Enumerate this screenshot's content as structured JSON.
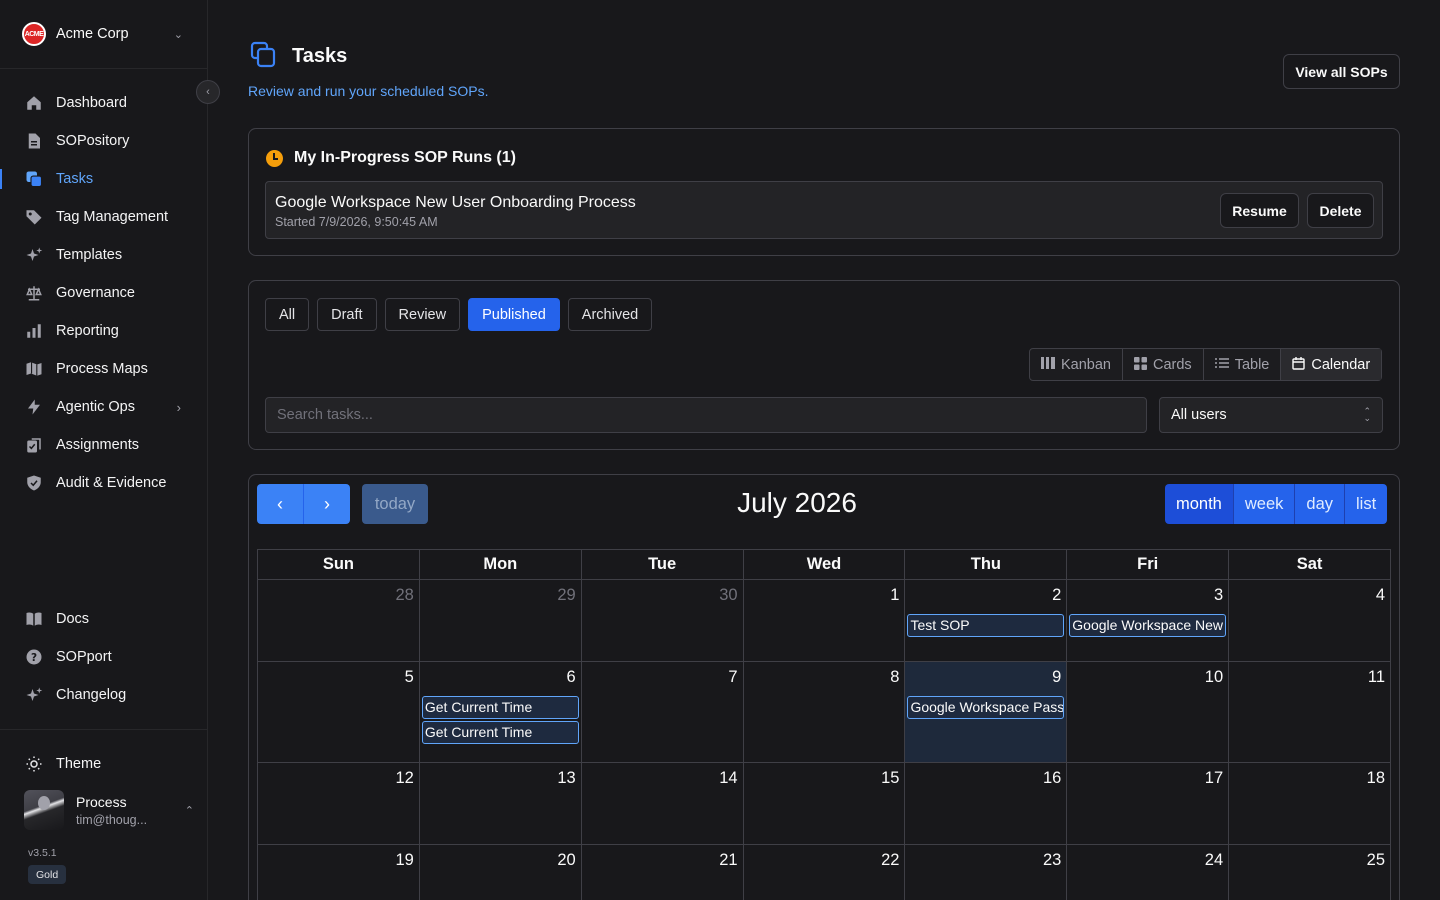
{
  "org": {
    "name": "Acme Corp",
    "logo_text": "ACME"
  },
  "sidebar": {
    "items": [
      {
        "label": "Dashboard",
        "icon": "home-icon"
      },
      {
        "label": "SOPository",
        "icon": "document-icon"
      },
      {
        "label": "Tasks",
        "icon": "copy-icon",
        "active": true
      },
      {
        "label": "Tag Management",
        "icon": "tag-icon"
      },
      {
        "label": "Templates",
        "icon": "sparkles-icon"
      },
      {
        "label": "Governance",
        "icon": "scale-icon"
      },
      {
        "label": "Reporting",
        "icon": "bar-chart-icon"
      },
      {
        "label": "Process Maps",
        "icon": "map-icon"
      },
      {
        "label": "Agentic Ops",
        "icon": "bolt-icon"
      },
      {
        "label": "Assignments",
        "icon": "clipboard-icon"
      },
      {
        "label": "Audit & Evidence",
        "icon": "shield-icon"
      }
    ],
    "footer_items": [
      {
        "label": "Docs",
        "icon": "book-icon"
      },
      {
        "label": "SOPport",
        "icon": "help-circle-icon"
      },
      {
        "label": "Changelog",
        "icon": "sparkles-icon"
      }
    ],
    "theme_label": "Theme",
    "user": {
      "name": "Process",
      "email": "tim@thoug..."
    },
    "version": "v3.5.1",
    "plan": "Gold"
  },
  "page": {
    "title": "Tasks",
    "subtitle": "Review and run your scheduled SOPs.",
    "view_all_label": "View all SOPs"
  },
  "in_progress": {
    "title": "My In-Progress SOP Runs (1)",
    "runs": [
      {
        "name": "Google Workspace New User Onboarding Process",
        "started": "Started 7/9/2026, 9:50:45 AM"
      }
    ],
    "resume_label": "Resume",
    "delete_label": "Delete"
  },
  "filters": {
    "tabs": [
      "All",
      "Draft",
      "Review",
      "Published",
      "Archived"
    ],
    "active_tab": "Published",
    "views": [
      "Kanban",
      "Cards",
      "Table",
      "Calendar"
    ],
    "active_view": "Calendar",
    "search_placeholder": "Search tasks...",
    "user_filter": "All users"
  },
  "calendar": {
    "title": "July 2026",
    "today_label": "today",
    "modes": [
      "month",
      "week",
      "day",
      "list"
    ],
    "active_mode": "month",
    "weekdays": [
      "Sun",
      "Mon",
      "Tue",
      "Wed",
      "Thu",
      "Fri",
      "Sat"
    ],
    "weeks": [
      [
        {
          "n": "28",
          "other": true
        },
        {
          "n": "29",
          "other": true
        },
        {
          "n": "30",
          "other": true
        },
        {
          "n": "1"
        },
        {
          "n": "2",
          "events": [
            "Test SOP"
          ]
        },
        {
          "n": "3",
          "events": [
            "Google Workspace New User Onboarding Process"
          ]
        },
        {
          "n": "4"
        }
      ],
      [
        {
          "n": "5"
        },
        {
          "n": "6",
          "events": [
            "Get Current Time",
            "Get Current Time"
          ]
        },
        {
          "n": "7"
        },
        {
          "n": "8"
        },
        {
          "n": "9",
          "today": true,
          "events": [
            "Google Workspace Password Reset"
          ]
        },
        {
          "n": "10"
        },
        {
          "n": "11"
        }
      ],
      [
        {
          "n": "12"
        },
        {
          "n": "13"
        },
        {
          "n": "14"
        },
        {
          "n": "15"
        },
        {
          "n": "16"
        },
        {
          "n": "17"
        },
        {
          "n": "18"
        }
      ],
      [
        {
          "n": "19"
        },
        {
          "n": "20"
        },
        {
          "n": "21"
        },
        {
          "n": "22"
        },
        {
          "n": "23"
        },
        {
          "n": "24"
        },
        {
          "n": "25"
        }
      ]
    ]
  },
  "colors": {
    "accent": "#3b82f6",
    "background": "#18181b",
    "border": "#3f3f46",
    "warning": "#f59e0b"
  }
}
